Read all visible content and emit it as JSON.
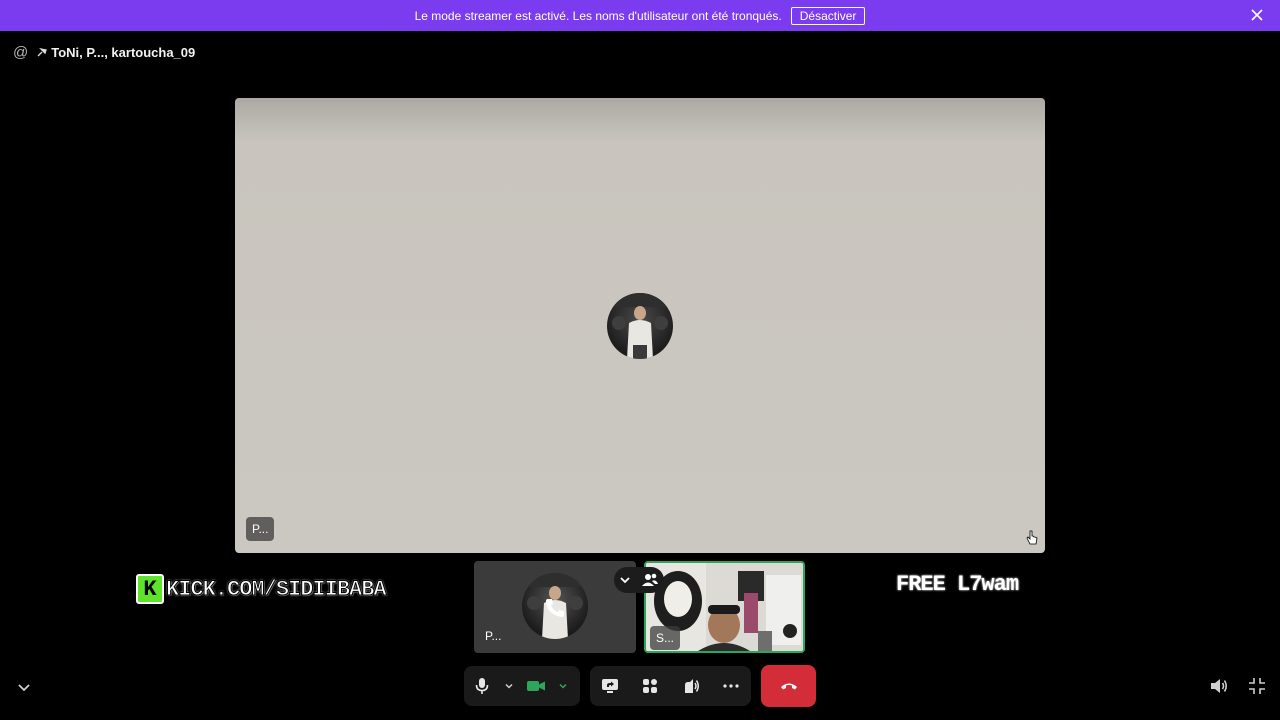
{
  "banner": {
    "message": "Le mode streamer est activé. Les noms d'utilisateur ont été tronqués.",
    "button_label": "Désactiver",
    "background": "#7b3bef"
  },
  "header": {
    "at_icon": "at-icon",
    "title": "ToNi, P..., kartoucha_09"
  },
  "main_tile": {
    "name": "P..."
  },
  "watermarks": {
    "left_k": "K",
    "left_text": "KICK.COM/SIDIIBABA",
    "right_text": "FREE L7wam"
  },
  "participants": [
    {
      "name": "P..."
    },
    {
      "name": "S..."
    }
  ],
  "controls": {
    "end_call_color": "#d22d39",
    "camera_color": "#2fa55c",
    "speaking_border": "#2fa55c"
  }
}
